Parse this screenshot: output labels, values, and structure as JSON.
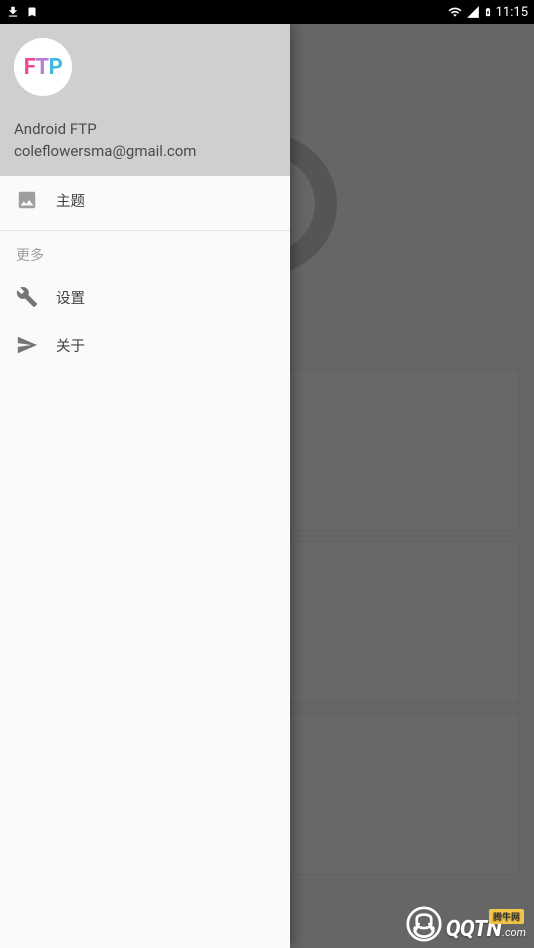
{
  "statusBar": {
    "time": "11:15"
  },
  "drawer": {
    "header": {
      "avatarText": {
        "f": "F",
        "t": "T",
        "p": "P"
      },
      "appName": "Android FTP",
      "email": "coleflowersma@gmail.com"
    },
    "items": {
      "theme": "主题"
    },
    "sectionMore": "更多",
    "moreItems": {
      "settings": "设置",
      "about": "关于"
    }
  },
  "watermark": {
    "brand": "QQTN",
    "suffix": ".com",
    "badge": "腾牛网"
  }
}
